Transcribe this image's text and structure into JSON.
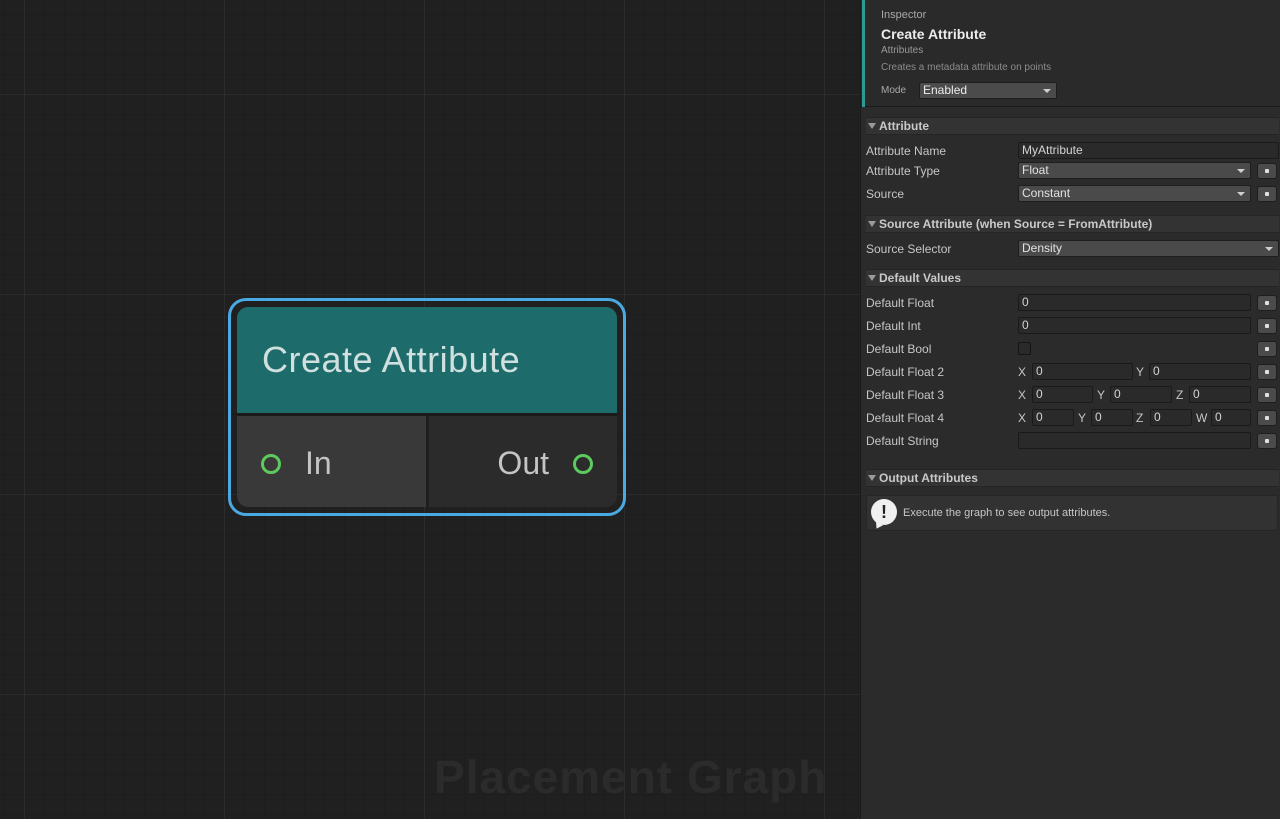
{
  "graph": {
    "watermark": "Placement Graph",
    "node": {
      "title": "Create Attribute",
      "input_label": "In",
      "output_label": "Out",
      "header_color": "#1e6b6b",
      "selection_color": "#4aa9e2",
      "port_color": "#5ec95e"
    }
  },
  "inspector": {
    "label": "Inspector",
    "title": "Create Attribute",
    "category": "Attributes",
    "description": "Creates a metadata attribute on points",
    "mode_label": "Mode",
    "mode_value": "Enabled",
    "accent_color": "#2c9a94",
    "sections": {
      "attribute": {
        "title": "Attribute",
        "name_label": "Attribute Name",
        "name_value": "MyAttribute",
        "type_label": "Attribute Type",
        "type_value": "Float",
        "source_label": "Source",
        "source_value": "Constant"
      },
      "source_attribute": {
        "title": "Source Attribute (when Source = FromAttribute)",
        "selector_label": "Source Selector",
        "selector_value": "Density"
      },
      "defaults": {
        "title": "Default Values",
        "float_label": "Default Float",
        "float_value": "0",
        "int_label": "Default Int",
        "int_value": "0",
        "bool_label": "Default Bool",
        "bool_value": false,
        "float2_label": "Default Float 2",
        "float2": {
          "x": "0",
          "y": "0"
        },
        "float3_label": "Default Float 3",
        "float3": {
          "x": "0",
          "y": "0",
          "z": "0"
        },
        "float4_label": "Default Float 4",
        "float4": {
          "x": "0",
          "y": "0",
          "z": "0",
          "w": "0"
        },
        "string_label": "Default String",
        "string_value": ""
      },
      "output": {
        "title": "Output Attributes",
        "help_text": "Execute the graph to see output attributes."
      }
    },
    "axis_labels": {
      "x": "X",
      "y": "Y",
      "z": "Z",
      "w": "W"
    }
  }
}
